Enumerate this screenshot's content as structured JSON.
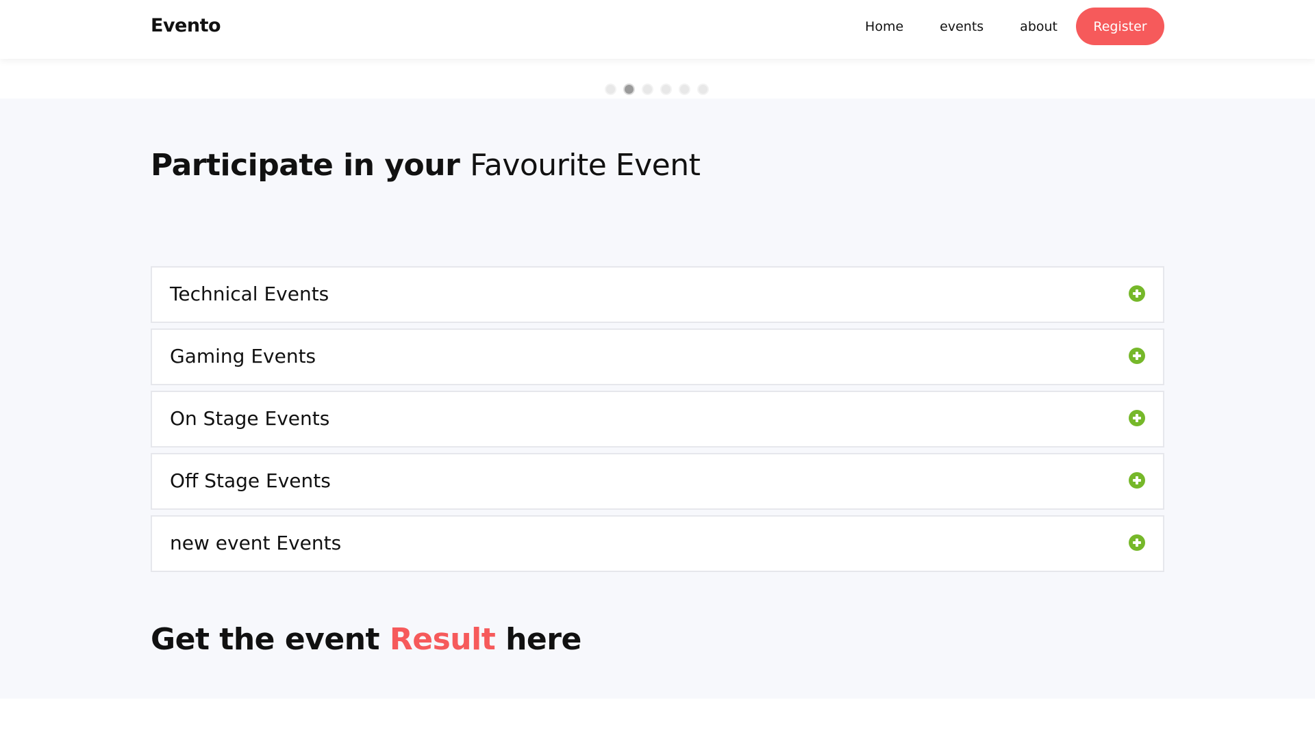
{
  "navbar": {
    "brand": "Evento",
    "links": [
      "Home",
      "events",
      "about"
    ],
    "register_label": "Register"
  },
  "carousel": {
    "dot_count": 6,
    "active_index": 1
  },
  "section": {
    "heading_bold": "Participate in your",
    "heading_light": "Favourite Event",
    "accordion_items": [
      {
        "label": "Technical Events",
        "icon": "plus-circle-icon"
      },
      {
        "label": "Gaming Events",
        "icon": "plus-circle-icon"
      },
      {
        "label": "On Stage Events",
        "icon": "plus-circle-icon"
      },
      {
        "label": "Off Stage Events",
        "icon": "plus-circle-icon"
      },
      {
        "label": "new event Events",
        "icon": "plus-circle-icon"
      }
    ]
  },
  "result": {
    "prefix": "Get the event",
    "highlight": "Result",
    "suffix": "here"
  },
  "colors": {
    "accent": "#f65a5b",
    "plus_icon": "#76b82a",
    "section_background": "#f7f8fc"
  }
}
